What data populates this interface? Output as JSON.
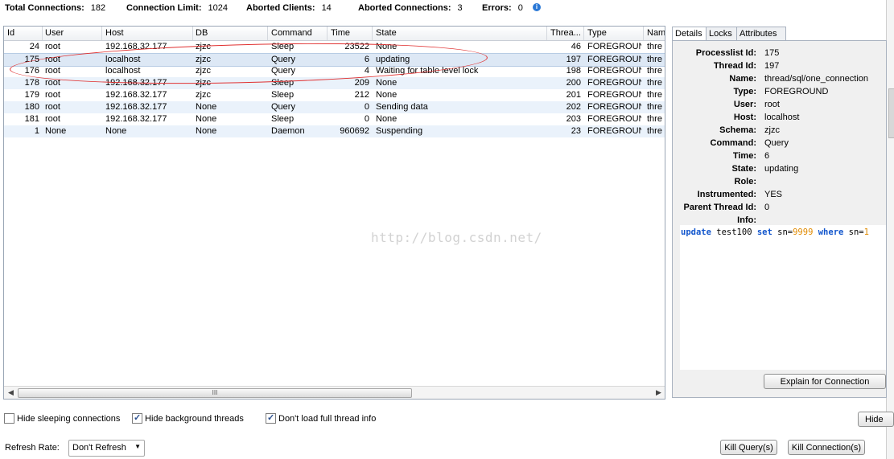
{
  "stats": [
    {
      "label": "Total Connections:",
      "value": "182"
    },
    {
      "label": "Connection Limit:",
      "value": "1024"
    },
    {
      "label": "Aborted Clients:",
      "value": "14"
    },
    {
      "label": "Aborted Connections:",
      "value": "3"
    },
    {
      "label": "Errors:",
      "value": "0"
    }
  ],
  "info_icon": "i",
  "table": {
    "columns": [
      "Id",
      "User",
      "Host",
      "DB",
      "Command",
      "Time",
      "State",
      "Threa...",
      "Type",
      "Nam"
    ],
    "rows": [
      [
        "24",
        "root",
        "192.168.32.177",
        "zjzc",
        "Sleep",
        "23522",
        "None",
        "46",
        "FOREGROUND",
        "thre"
      ],
      [
        "175",
        "root",
        "localhost",
        "zjzc",
        "Query",
        "6",
        "updating",
        "197",
        "FOREGROUND",
        "thre"
      ],
      [
        "176",
        "root",
        "localhost",
        "zjzc",
        "Query",
        "4",
        "Waiting for table level lock",
        "198",
        "FOREGROUND",
        "thre"
      ],
      [
        "178",
        "root",
        "192.168.32.177",
        "zjzc",
        "Sleep",
        "209",
        "None",
        "200",
        "FOREGROUND",
        "thre"
      ],
      [
        "179",
        "root",
        "192.168.32.177",
        "zjzc",
        "Sleep",
        "212",
        "None",
        "201",
        "FOREGROUND",
        "thre"
      ],
      [
        "180",
        "root",
        "192.168.32.177",
        "None",
        "Query",
        "0",
        "Sending data",
        "202",
        "FOREGROUND",
        "thre"
      ],
      [
        "181",
        "root",
        "192.168.32.177",
        "None",
        "Sleep",
        "0",
        "None",
        "203",
        "FOREGROUND",
        "thre"
      ],
      [
        "1",
        "None",
        "None",
        "None",
        "Daemon",
        "960692",
        "Suspending",
        "23",
        "FOREGROUND",
        "thre"
      ]
    ],
    "scroll_thumb_grip": "III"
  },
  "watermark": "http://blog.csdn.net/",
  "tabs": [
    "Details",
    "Locks",
    "Attributes"
  ],
  "details": [
    {
      "label": "Processlist Id:",
      "value": "175"
    },
    {
      "label": "Thread Id:",
      "value": "197"
    },
    {
      "label": "Name:",
      "value": "thread/sql/one_connection"
    },
    {
      "label": "Type:",
      "value": "FOREGROUND"
    },
    {
      "label": "User:",
      "value": "root"
    },
    {
      "label": "Host:",
      "value": "localhost"
    },
    {
      "label": "Schema:",
      "value": "zjzc"
    },
    {
      "label": "Command:",
      "value": "Query"
    },
    {
      "label": "Time:",
      "value": "6"
    },
    {
      "label": "State:",
      "value": "updating"
    },
    {
      "label": "Role:",
      "value": ""
    },
    {
      "label": "Instrumented:",
      "value": "YES"
    },
    {
      "label": "Parent Thread Id:",
      "value": "0"
    },
    {
      "label": "Info:",
      "value": ""
    }
  ],
  "sql": {
    "kw1": "update",
    "t1": " test100 ",
    "kw2": "set",
    "t2": " sn=",
    "n1": "9999",
    "t3": " ",
    "kw3": "where",
    "t4": " sn=",
    "n2": "1"
  },
  "buttons": {
    "explain": "Explain for Connection",
    "hide": "Hide",
    "kill_query": "Kill Query(s)",
    "kill_connection": "Kill Connection(s)"
  },
  "options": [
    {
      "label": "Hide sleeping connections",
      "checked": false
    },
    {
      "label": "Hide background threads",
      "checked": true
    },
    {
      "label": "Don't load full thread info",
      "checked": true
    }
  ],
  "refresh": {
    "label": "Refresh Rate:",
    "value": "Don't Refresh"
  },
  "colors": {
    "keyword": "#1155cc",
    "number": "#e08a00",
    "annotation": "#e03030"
  }
}
